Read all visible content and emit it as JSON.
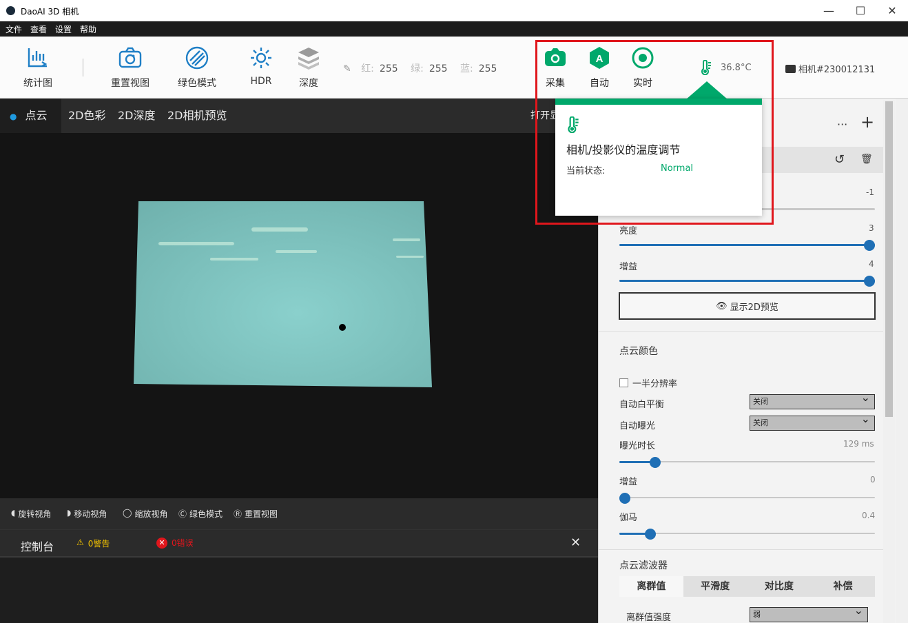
{
  "window": {
    "title": "DaoAI 3D 相机",
    "minimize": "—",
    "maximize": "☐",
    "close": "✕"
  },
  "menu": [
    "文件",
    "查看",
    "设置",
    "帮助"
  ],
  "toolbar": {
    "stats": "统计图",
    "reset_view": "重置视图",
    "green_mode": "绿色模式",
    "hdr": "HDR",
    "depth": "深度",
    "rgb": {
      "r_label": "红:",
      "r": "255",
      "g_label": "绿:",
      "g": "255",
      "b_label": "蓝:",
      "b": "255"
    },
    "capture": "采集",
    "auto": "自动",
    "live": "实时",
    "temperature": "36.8°C",
    "camera_id": "相机#230012131"
  },
  "tabs": [
    "点云",
    "2D色彩",
    "2D深度",
    "2D相机预览"
  ],
  "tab_overflow": "打开显",
  "hints": [
    "旋转视角",
    "移动视角",
    "缩放视角",
    "绿色模式",
    "重置视图"
  ],
  "console": {
    "title": "控制台",
    "warnings": "0警告",
    "errors": "0错误",
    "close": "✕"
  },
  "popover": {
    "title": "相机/投影仪的温度调节",
    "status_label": "当前状态:",
    "status_value": "Normal"
  },
  "panel": {
    "more": "···",
    "add": "+",
    "reset": "↺",
    "delete": "🗑",
    "top_slider_value": "-1",
    "brightness": {
      "label": "亮度",
      "value": "3",
      "fraction": 1.0
    },
    "gain_top": {
      "label": "增益",
      "value": "4",
      "fraction": 1.0
    },
    "show_2d": "显示2D预览",
    "color_section": "点云颜色",
    "half_res": "一半分辨率",
    "awb": {
      "label": "自动白平衡",
      "value": "关闭"
    },
    "ae": {
      "label": "自动曝光",
      "value": "关闭"
    },
    "exposure": {
      "label": "曝光时长",
      "value": "129 ms",
      "fraction": 0.14
    },
    "gain": {
      "label": "增益",
      "value": "0",
      "fraction": 0.0
    },
    "gamma": {
      "label": "伽马",
      "value": "0.4",
      "fraction": 0.12
    },
    "filter_section": "点云滤波器",
    "filter_tabs": [
      "离群值",
      "平滑度",
      "对比度",
      "补偿"
    ],
    "outlier_strength": {
      "label": "离群值强度",
      "value": "弱"
    }
  },
  "colors": {
    "accent": "#00a86b",
    "blue": "#1f6fb5",
    "red": "#e0161c"
  }
}
